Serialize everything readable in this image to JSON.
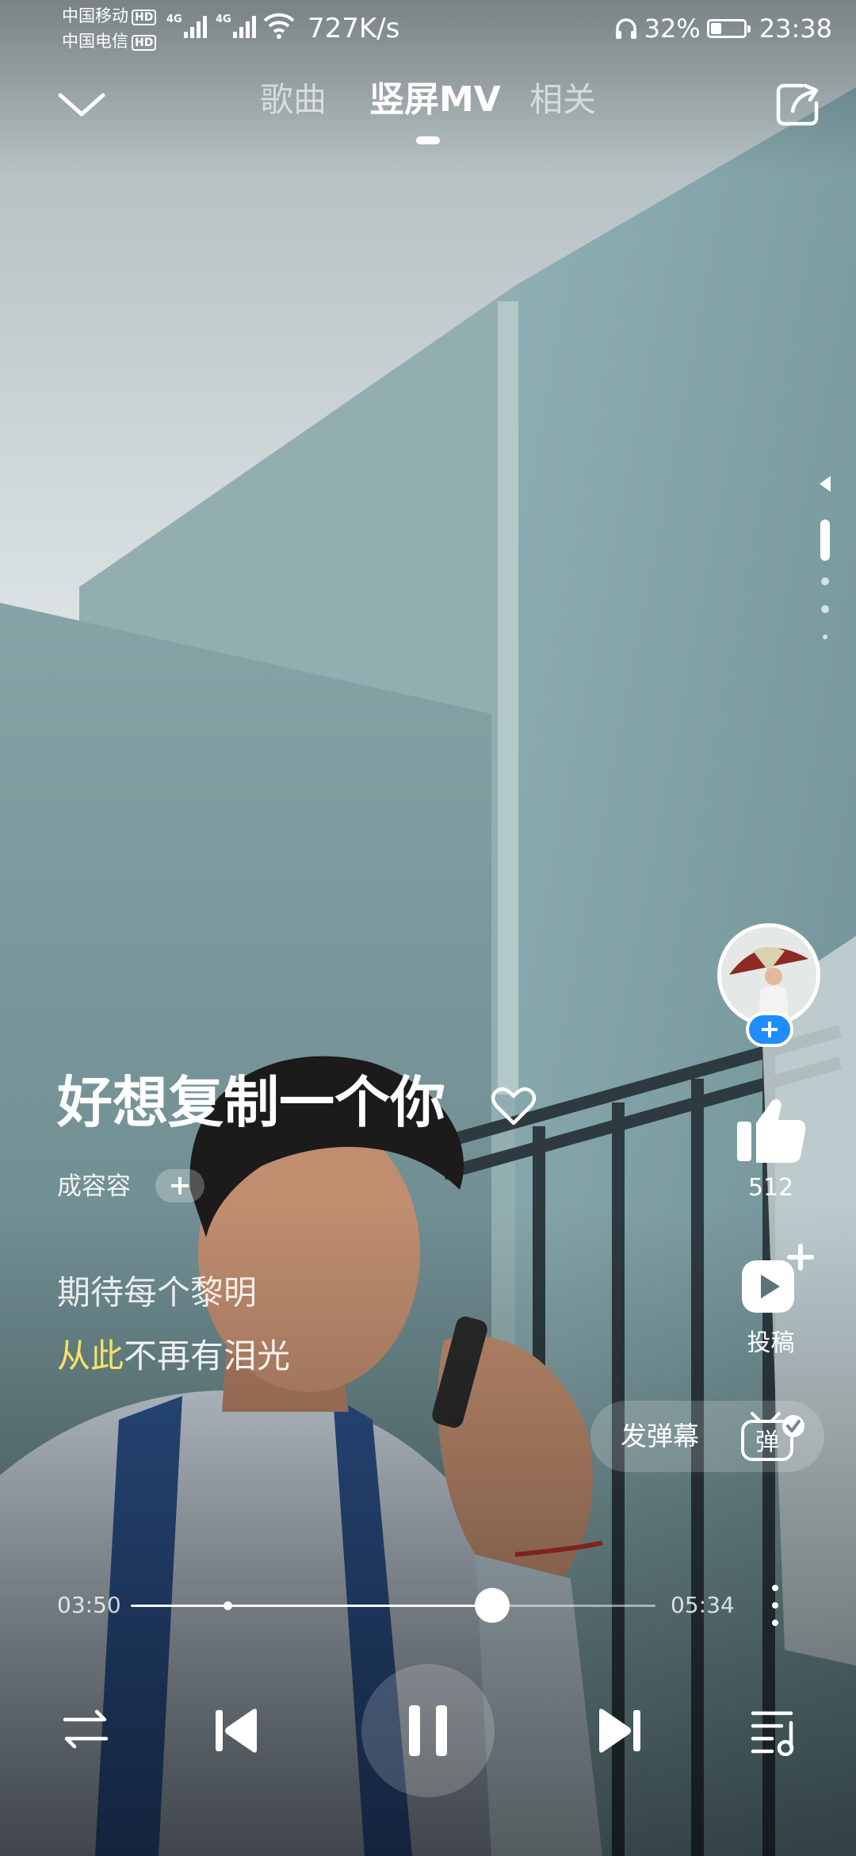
{
  "status_bar": {
    "carrier_1": "中国移动",
    "carrier_2": "中国电信",
    "hd_badge": "HD",
    "network_type": "4G",
    "net_speed": "727K/s",
    "battery_percent": "32%",
    "battery_level": 0.32,
    "time": "23:38"
  },
  "nav": {
    "tabs": [
      {
        "label": "歌曲",
        "active": false
      },
      {
        "label": "竖屏MV",
        "active": true
      },
      {
        "label": "相关",
        "active": false
      }
    ],
    "collapse_icon": "chevron-down-icon",
    "share_icon": "share-icon"
  },
  "song": {
    "title": "好想复制一个你",
    "artist": "成容容"
  },
  "lyrics": {
    "line_1": "期待每个黎明",
    "line_2_highlight": "从此",
    "line_2_rest": "不再有泪光"
  },
  "actions": {
    "like_count": "512",
    "upload_label": "投稿",
    "danmaku_label": "发弹幕",
    "danmaku_icon_text": "弹"
  },
  "progress": {
    "current": "03:50",
    "total": "05:34",
    "fraction": 0.6886
  },
  "controls": {
    "mode_icon": "repeat-icon",
    "prev_icon": "skip-previous-icon",
    "play_state_icon": "pause-icon",
    "next_icon": "skip-next-icon",
    "playlist_icon": "playlist-icon"
  },
  "colors": {
    "lyric_highlight": "#f5e463",
    "follow_accent": "#1f8cff"
  }
}
